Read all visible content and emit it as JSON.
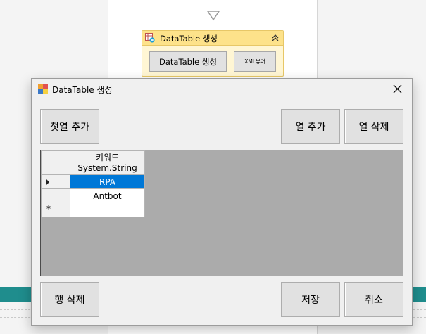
{
  "designer": {
    "activity_title": "DataTable 생성",
    "build_button": "DataTable 생성",
    "xml_button": "XML뷰어"
  },
  "dialog": {
    "title": "DataTable 생성",
    "buttons": {
      "add_first_column": "첫열 추가",
      "add_column": "열 추가",
      "delete_column": "열 삭제",
      "delete_row": "행 삭제",
      "save": "저장",
      "cancel": "취소"
    },
    "grid": {
      "column_header_line1": "키워드",
      "column_header_line2": "System.String",
      "rows": [
        "RPA",
        "Antbot",
        ""
      ],
      "new_row_marker": "*"
    }
  },
  "colors": {
    "selection": "#0078d7",
    "activity_header": "#fde28a",
    "teal_bar": "#1f8d8d"
  },
  "icons": [
    "flow-arrow-down-icon",
    "datatable-add-icon",
    "collapse-chevrons-icon",
    "app-icon",
    "close-icon",
    "current-row-arrow-icon"
  ]
}
